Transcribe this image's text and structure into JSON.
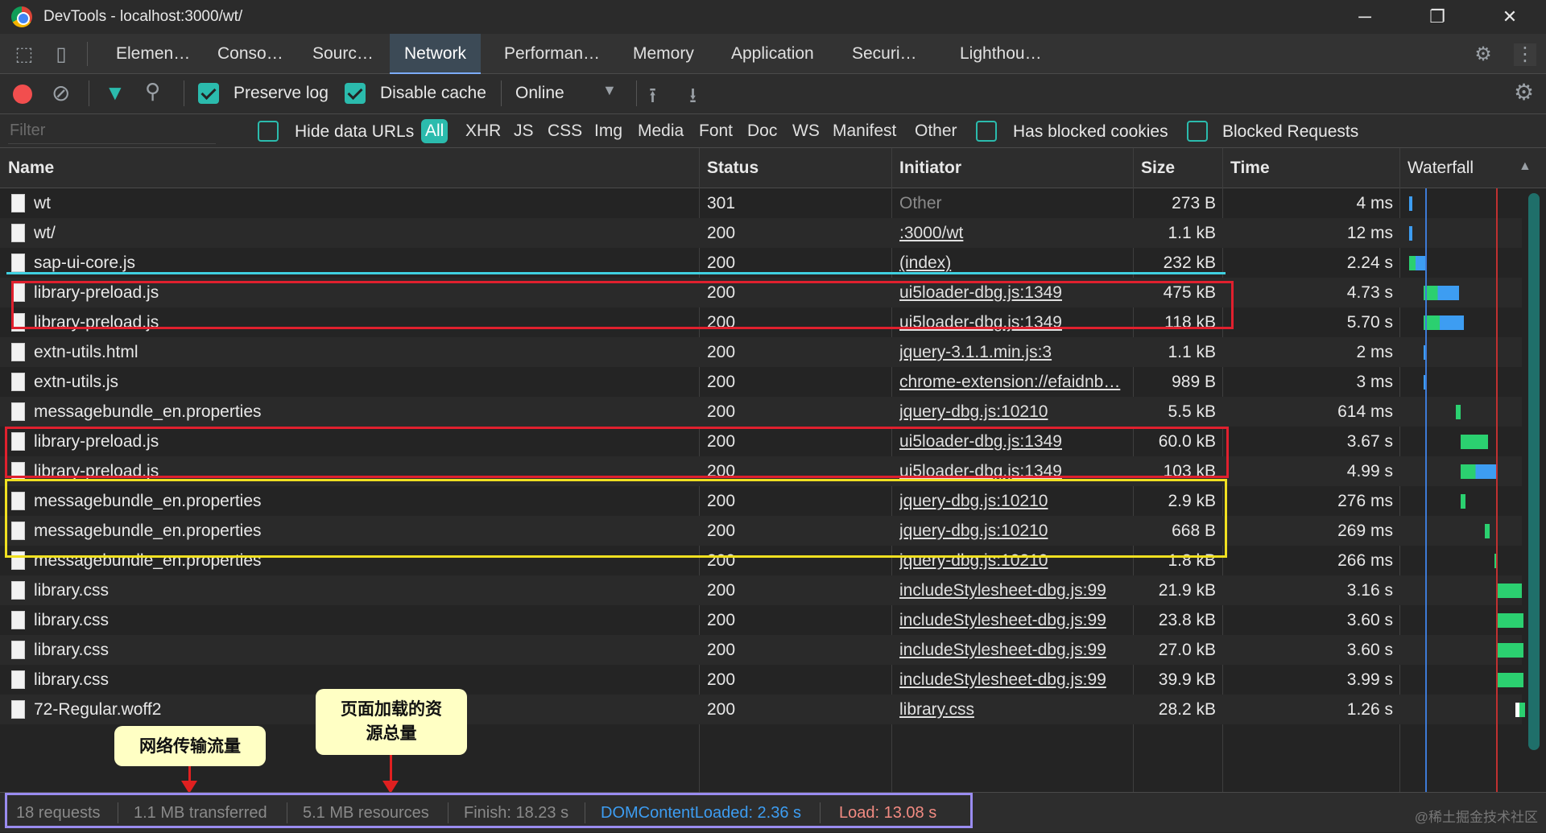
{
  "window": {
    "title": "DevTools - localhost:3000/wt/",
    "minimize": "─",
    "maximize": "❐",
    "close": "✕"
  },
  "tabs": [
    {
      "label": "Elemen…"
    },
    {
      "label": "Conso…"
    },
    {
      "label": "Sourc…"
    },
    {
      "label": "Network",
      "active": true
    },
    {
      "label": "Performan…"
    },
    {
      "label": "Memory"
    },
    {
      "label": "Application"
    },
    {
      "label": "Securi…"
    },
    {
      "label": "Lighthou…"
    }
  ],
  "toolbar": {
    "preserve_log": "Preserve log",
    "preserve_log_checked": true,
    "disable_cache": "Disable cache",
    "disable_cache_checked": true,
    "throttling": "Online"
  },
  "filter": {
    "placeholder": "Filter",
    "hide_data_urls": "Hide data URLs",
    "types": [
      "All",
      "XHR",
      "JS",
      "CSS",
      "Img",
      "Media",
      "Font",
      "Doc",
      "WS",
      "Manifest",
      "Other"
    ],
    "has_blocked_cookies": "Has blocked cookies",
    "blocked_requests": "Blocked Requests"
  },
  "columns": {
    "name": "Name",
    "status": "Status",
    "initiator": "Initiator",
    "size": "Size",
    "time": "Time",
    "waterfall": "Waterfall"
  },
  "requests": [
    {
      "name": "wt",
      "status": "301",
      "initiator": "Other",
      "initiator_link": false,
      "size": "273 B",
      "time": "4 ms"
    },
    {
      "name": "wt/",
      "status": "200",
      "initiator": ":3000/wt",
      "initiator_link": true,
      "size": "1.1 kB",
      "time": "12 ms"
    },
    {
      "name": "sap-ui-core.js",
      "status": "200",
      "initiator": "(index)",
      "initiator_link": true,
      "size": "232 kB",
      "time": "2.24 s"
    },
    {
      "name": "library-preload.js",
      "status": "200",
      "initiator": "ui5loader-dbg.js:1349",
      "initiator_link": true,
      "size": "475 kB",
      "time": "4.73 s"
    },
    {
      "name": "library-preload.js",
      "status": "200",
      "initiator": "ui5loader-dbg.js:1349",
      "initiator_link": true,
      "size": "118 kB",
      "time": "5.70 s"
    },
    {
      "name": "extn-utils.html",
      "status": "200",
      "initiator": "jquery-3.1.1.min.js:3",
      "initiator_link": true,
      "size": "1.1 kB",
      "time": "2 ms"
    },
    {
      "name": "extn-utils.js",
      "status": "200",
      "initiator": "chrome-extension://efaidnb…",
      "initiator_link": true,
      "size": "989 B",
      "time": "3 ms"
    },
    {
      "name": "messagebundle_en.properties",
      "status": "200",
      "initiator": "jquery-dbg.js:10210",
      "initiator_link": true,
      "size": "5.5 kB",
      "time": "614 ms"
    },
    {
      "name": "library-preload.js",
      "status": "200",
      "initiator": "ui5loader-dbg.js:1349",
      "initiator_link": true,
      "size": "60.0 kB",
      "time": "3.67 s"
    },
    {
      "name": "library-preload.js",
      "status": "200",
      "initiator": "ui5loader-dbg.js:1349",
      "initiator_link": true,
      "size": "103 kB",
      "time": "4.99 s"
    },
    {
      "name": "messagebundle_en.properties",
      "status": "200",
      "initiator": "jquery-dbg.js:10210",
      "initiator_link": true,
      "size": "2.9 kB",
      "time": "276 ms"
    },
    {
      "name": "messagebundle_en.properties",
      "status": "200",
      "initiator": "jquery-dbg.js:10210",
      "initiator_link": true,
      "size": "668 B",
      "time": "269 ms"
    },
    {
      "name": "messagebundle_en.properties",
      "status": "200",
      "initiator": "jquery-dbg.js:10210",
      "initiator_link": true,
      "size": "1.8 kB",
      "time": "266 ms"
    },
    {
      "name": "library.css",
      "status": "200",
      "initiator": "includeStylesheet-dbg.js:99",
      "initiator_link": true,
      "size": "21.9 kB",
      "time": "3.16 s"
    },
    {
      "name": "library.css",
      "status": "200",
      "initiator": "includeStylesheet-dbg.js:99",
      "initiator_link": true,
      "size": "23.8 kB",
      "time": "3.60 s"
    },
    {
      "name": "library.css",
      "status": "200",
      "initiator": "includeStylesheet-dbg.js:99",
      "initiator_link": true,
      "size": "27.0 kB",
      "time": "3.60 s"
    },
    {
      "name": "library.css",
      "status": "200",
      "initiator": "includeStylesheet-dbg.js:99",
      "initiator_link": true,
      "size": "39.9 kB",
      "time": "3.99 s"
    },
    {
      "name": "72-Regular.woff2",
      "status": "200",
      "initiator": "library.css",
      "initiator_link": true,
      "size": "28.2 kB",
      "time": "1.26 s"
    }
  ],
  "callouts": {
    "transferred_note": "网络传输流量",
    "resources_note_line1": "页面加载的资",
    "resources_note_line2": "源总量"
  },
  "status": {
    "requests": "18 requests",
    "transferred": "1.1 MB transferred",
    "resources": "5.1 MB resources",
    "finish": "Finish: 18.23 s",
    "dom_content_loaded": "DOMContentLoaded: 2.36 s",
    "load": "Load: 13.08 s"
  },
  "watermark": "@稀土掘金技术社区",
  "colors": {
    "accent": "#2bbbad",
    "dcl": "#3d9df2",
    "load": "#f28b82",
    "highlight_red": "#e0202e",
    "highlight_yellow": "#f0e020",
    "highlight_cyan": "#3fd0e0",
    "highlight_purple": "#9a8cf0"
  }
}
